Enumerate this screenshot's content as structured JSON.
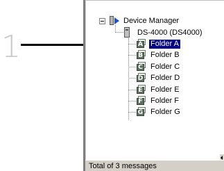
{
  "callout": {
    "step_number": "1"
  },
  "tree": {
    "root_label": "Device Manager",
    "device_label": "DS-4000 (DS4000)",
    "folders": [
      {
        "letter": "A",
        "label": "Folder A",
        "selected": true
      },
      {
        "letter": "B",
        "label": "Folder B",
        "selected": false
      },
      {
        "letter": "C",
        "label": "Folder C",
        "selected": false
      },
      {
        "letter": "D",
        "label": "Folder D",
        "selected": false
      },
      {
        "letter": "E",
        "label": "Folder E",
        "selected": false
      },
      {
        "letter": "F",
        "label": "Folder F",
        "selected": false
      },
      {
        "letter": "G",
        "label": "Folder G",
        "selected": false
      }
    ]
  },
  "status_bar": {
    "text": "Total of 3 messages"
  },
  "colors": {
    "selection": "#000080",
    "folder_front": "#5f6f5f",
    "device_manager_arrow": "#1e50c8"
  },
  "icons": {
    "root": "device-manager-icon",
    "device": "recorder-icon",
    "folder": "folder-icon"
  }
}
